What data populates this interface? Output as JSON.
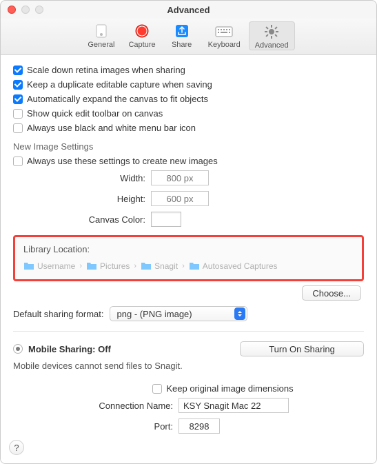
{
  "window": {
    "title": "Advanced"
  },
  "toolbar": {
    "items": [
      {
        "label": "General"
      },
      {
        "label": "Capture"
      },
      {
        "label": "Share"
      },
      {
        "label": "Keyboard"
      },
      {
        "label": "Advanced"
      }
    ]
  },
  "checks": {
    "scale": "Scale down retina images when sharing",
    "duplicate": "Keep a duplicate editable capture when saving",
    "expand": "Automatically expand the canvas to fit objects",
    "quickedit": "Show quick edit toolbar on canvas",
    "bwmenubar": "Always use black and white menu bar icon"
  },
  "newimg": {
    "header": "New Image Settings",
    "always": "Always use these settings to create new images",
    "width_label": "Width:",
    "height_label": "Height:",
    "width_ph": "800 px",
    "height_ph": "600 px",
    "color_label": "Canvas Color:"
  },
  "library": {
    "header": "Library Location:",
    "crumbs": [
      "Username",
      "Pictures",
      "Snagit",
      "Autosaved Captures"
    ],
    "choose": "Choose..."
  },
  "sharing": {
    "label": "Default sharing format:",
    "value": "png - (PNG image)"
  },
  "mobile": {
    "title": "Mobile Sharing: Off",
    "button": "Turn On Sharing",
    "subtext": "Mobile devices cannot send files to Snagit.",
    "keep": "Keep original image dimensions",
    "conn_label": "Connection Name:",
    "conn_value": "KSY Snagit Mac 22",
    "port_label": "Port:",
    "port_value": "8298"
  },
  "help": "?"
}
